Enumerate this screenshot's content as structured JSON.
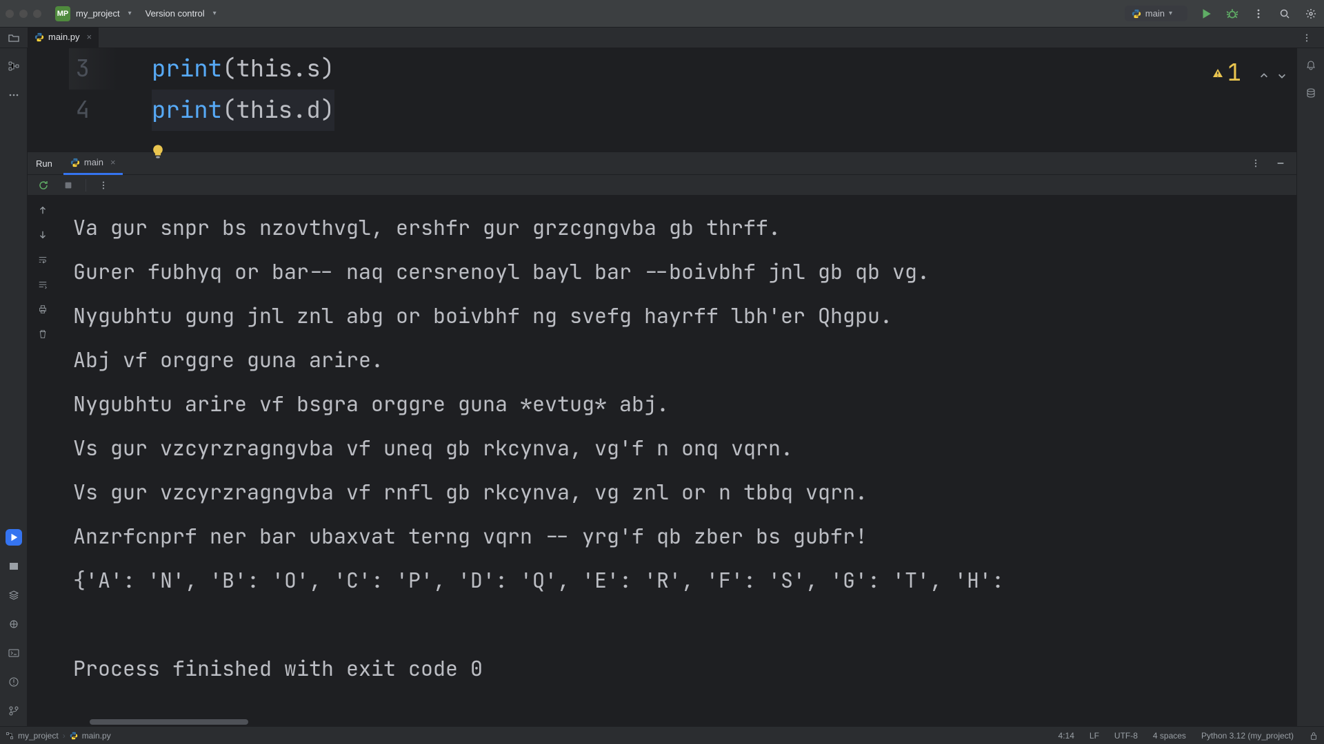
{
  "titlebar": {
    "project_badge": "MP",
    "project_name": "my_project",
    "vcs_label": "Version control"
  },
  "run_config": {
    "name": "main"
  },
  "editor_tab": {
    "icon": "python",
    "filename": "main.py"
  },
  "problems": {
    "weak_warning_count": "1"
  },
  "editor": {
    "lines": [
      {
        "num": "3",
        "fn": "print",
        "arg_prefix": "this.",
        "arg_attr": "s"
      },
      {
        "num": "4",
        "fn": "print",
        "arg_prefix": "this.",
        "arg_attr": "d"
      }
    ]
  },
  "run_panel": {
    "title": "Run",
    "tab_label": "main"
  },
  "console_lines": [
    "Va gur snpr bs nzovthvgl, ershfr gur grzcgngvba gb thrff.",
    "Gurer fubhyq or bar-- naq cersrenoyl bayl bar --boivbhf jnl gb qb vg.",
    "Nygubhtu gung jnl znl abg or boivbhf ng svefg hayrff lbh'er Qhgpu.",
    "Abj vf orggre guna arire.",
    "Nygubhtu arire vf bsgra orggre guna *evtug* abj.",
    "Vs gur vzcyrzragngvba vf uneq gb rkcynva, vg'f n onq vqrn.",
    "Vs gur vzcyrzragngvba vf rnfl gb rkcynva, vg znl or n tbbq vqrn.",
    "Anzrfcnprf ner bar ubaxvat terng vqrn -- yrg'f qb zber bs gubfr!",
    "{'A': 'N', 'B': 'O', 'C': 'P', 'D': 'Q', 'E': 'R', 'F': 'S', 'G': 'T', 'H':",
    "",
    "Process finished with exit code 0"
  ],
  "statusbar": {
    "breadcrumbs": [
      "my_project",
      "main.py"
    ],
    "caret": "4:14",
    "line_sep": "LF",
    "encoding": "UTF-8",
    "indent": "4 spaces",
    "interpreter": "Python 3.12 (my_project)"
  }
}
